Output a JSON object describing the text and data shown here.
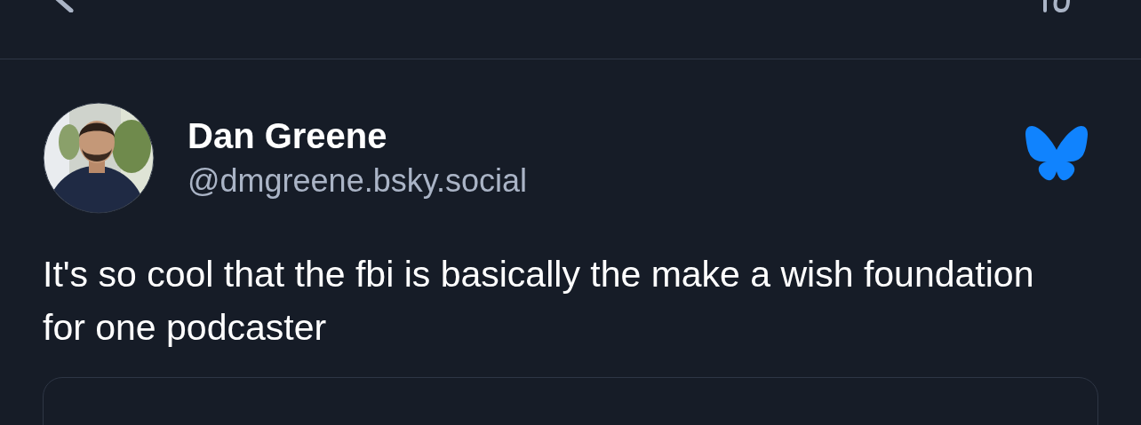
{
  "post": {
    "author": {
      "name": "Dan Greene",
      "handle": "@dmgreene.bsky.social"
    },
    "text": "It's so cool that the fbi is basically the make a wish foundation for one podcaster",
    "embed": {
      "kind": "card"
    }
  }
}
